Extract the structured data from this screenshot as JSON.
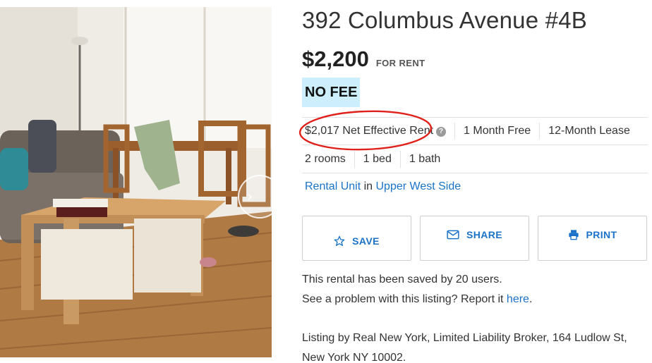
{
  "listing": {
    "title": "392 Columbus Avenue #4B",
    "price": "$2,200",
    "price_suffix": "FOR RENT",
    "no_fee_badge": "NO FEE"
  },
  "facts": {
    "net_effective": "$2,017 Net Effective Rent",
    "net_effective_help": "?",
    "free_months": "1 Month Free",
    "lease": "12-Month Lease",
    "rooms": "2 rooms",
    "beds": "1 bed",
    "baths": "1 bath"
  },
  "type_line": {
    "unit_type": "Rental Unit",
    "connector": " in ",
    "neighborhood": "Upper West Side"
  },
  "actions": {
    "save_label": "SAVE",
    "share_label": "SHARE",
    "print_label": "PRINT"
  },
  "info": {
    "saved_by": "This rental has been saved by 20 users.",
    "report_prefix": "See a problem with this listing? Report it ",
    "report_link": "here",
    "report_suffix": ".",
    "broker": "Listing by Real New York, Limited Liability Broker, 164 Ludlow St, New York NY 10002."
  },
  "colors": {
    "link": "#1a73c8",
    "no_fee_bg": "#cceefd",
    "annotation": "#e0201b"
  },
  "icons": {
    "photo_next": "chevron-right-icon",
    "save": "star-icon",
    "share": "envelope-icon",
    "print": "printer-icon",
    "help": "question-circle-icon"
  }
}
